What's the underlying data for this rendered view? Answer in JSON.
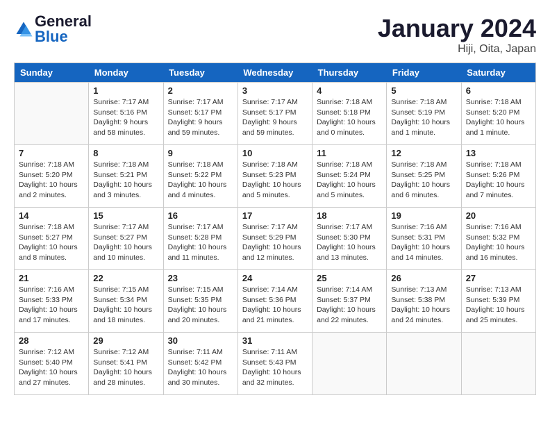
{
  "logo": {
    "text_general": "General",
    "text_blue": "Blue"
  },
  "header": {
    "title": "January 2024",
    "location": "Hiji, Oita, Japan"
  },
  "days_of_week": [
    "Sunday",
    "Monday",
    "Tuesday",
    "Wednesday",
    "Thursday",
    "Friday",
    "Saturday"
  ],
  "weeks": [
    [
      {
        "num": "",
        "info": ""
      },
      {
        "num": "1",
        "info": "Sunrise: 7:17 AM\nSunset: 5:16 PM\nDaylight: 9 hours and 58 minutes."
      },
      {
        "num": "2",
        "info": "Sunrise: 7:17 AM\nSunset: 5:17 PM\nDaylight: 9 hours and 59 minutes."
      },
      {
        "num": "3",
        "info": "Sunrise: 7:17 AM\nSunset: 5:17 PM\nDaylight: 9 hours and 59 minutes."
      },
      {
        "num": "4",
        "info": "Sunrise: 7:18 AM\nSunset: 5:18 PM\nDaylight: 10 hours and 0 minutes."
      },
      {
        "num": "5",
        "info": "Sunrise: 7:18 AM\nSunset: 5:19 PM\nDaylight: 10 hours and 1 minute."
      },
      {
        "num": "6",
        "info": "Sunrise: 7:18 AM\nSunset: 5:20 PM\nDaylight: 10 hours and 1 minute."
      }
    ],
    [
      {
        "num": "7",
        "info": "Sunrise: 7:18 AM\nSunset: 5:20 PM\nDaylight: 10 hours and 2 minutes."
      },
      {
        "num": "8",
        "info": "Sunrise: 7:18 AM\nSunset: 5:21 PM\nDaylight: 10 hours and 3 minutes."
      },
      {
        "num": "9",
        "info": "Sunrise: 7:18 AM\nSunset: 5:22 PM\nDaylight: 10 hours and 4 minutes."
      },
      {
        "num": "10",
        "info": "Sunrise: 7:18 AM\nSunset: 5:23 PM\nDaylight: 10 hours and 5 minutes."
      },
      {
        "num": "11",
        "info": "Sunrise: 7:18 AM\nSunset: 5:24 PM\nDaylight: 10 hours and 5 minutes."
      },
      {
        "num": "12",
        "info": "Sunrise: 7:18 AM\nSunset: 5:25 PM\nDaylight: 10 hours and 6 minutes."
      },
      {
        "num": "13",
        "info": "Sunrise: 7:18 AM\nSunset: 5:26 PM\nDaylight: 10 hours and 7 minutes."
      }
    ],
    [
      {
        "num": "14",
        "info": "Sunrise: 7:18 AM\nSunset: 5:27 PM\nDaylight: 10 hours and 8 minutes."
      },
      {
        "num": "15",
        "info": "Sunrise: 7:17 AM\nSunset: 5:27 PM\nDaylight: 10 hours and 10 minutes."
      },
      {
        "num": "16",
        "info": "Sunrise: 7:17 AM\nSunset: 5:28 PM\nDaylight: 10 hours and 11 minutes."
      },
      {
        "num": "17",
        "info": "Sunrise: 7:17 AM\nSunset: 5:29 PM\nDaylight: 10 hours and 12 minutes."
      },
      {
        "num": "18",
        "info": "Sunrise: 7:17 AM\nSunset: 5:30 PM\nDaylight: 10 hours and 13 minutes."
      },
      {
        "num": "19",
        "info": "Sunrise: 7:16 AM\nSunset: 5:31 PM\nDaylight: 10 hours and 14 minutes."
      },
      {
        "num": "20",
        "info": "Sunrise: 7:16 AM\nSunset: 5:32 PM\nDaylight: 10 hours and 16 minutes."
      }
    ],
    [
      {
        "num": "21",
        "info": "Sunrise: 7:16 AM\nSunset: 5:33 PM\nDaylight: 10 hours and 17 minutes."
      },
      {
        "num": "22",
        "info": "Sunrise: 7:15 AM\nSunset: 5:34 PM\nDaylight: 10 hours and 18 minutes."
      },
      {
        "num": "23",
        "info": "Sunrise: 7:15 AM\nSunset: 5:35 PM\nDaylight: 10 hours and 20 minutes."
      },
      {
        "num": "24",
        "info": "Sunrise: 7:14 AM\nSunset: 5:36 PM\nDaylight: 10 hours and 21 minutes."
      },
      {
        "num": "25",
        "info": "Sunrise: 7:14 AM\nSunset: 5:37 PM\nDaylight: 10 hours and 22 minutes."
      },
      {
        "num": "26",
        "info": "Sunrise: 7:13 AM\nSunset: 5:38 PM\nDaylight: 10 hours and 24 minutes."
      },
      {
        "num": "27",
        "info": "Sunrise: 7:13 AM\nSunset: 5:39 PM\nDaylight: 10 hours and 25 minutes."
      }
    ],
    [
      {
        "num": "28",
        "info": "Sunrise: 7:12 AM\nSunset: 5:40 PM\nDaylight: 10 hours and 27 minutes."
      },
      {
        "num": "29",
        "info": "Sunrise: 7:12 AM\nSunset: 5:41 PM\nDaylight: 10 hours and 28 minutes."
      },
      {
        "num": "30",
        "info": "Sunrise: 7:11 AM\nSunset: 5:42 PM\nDaylight: 10 hours and 30 minutes."
      },
      {
        "num": "31",
        "info": "Sunrise: 7:11 AM\nSunset: 5:43 PM\nDaylight: 10 hours and 32 minutes."
      },
      {
        "num": "",
        "info": ""
      },
      {
        "num": "",
        "info": ""
      },
      {
        "num": "",
        "info": ""
      }
    ]
  ]
}
